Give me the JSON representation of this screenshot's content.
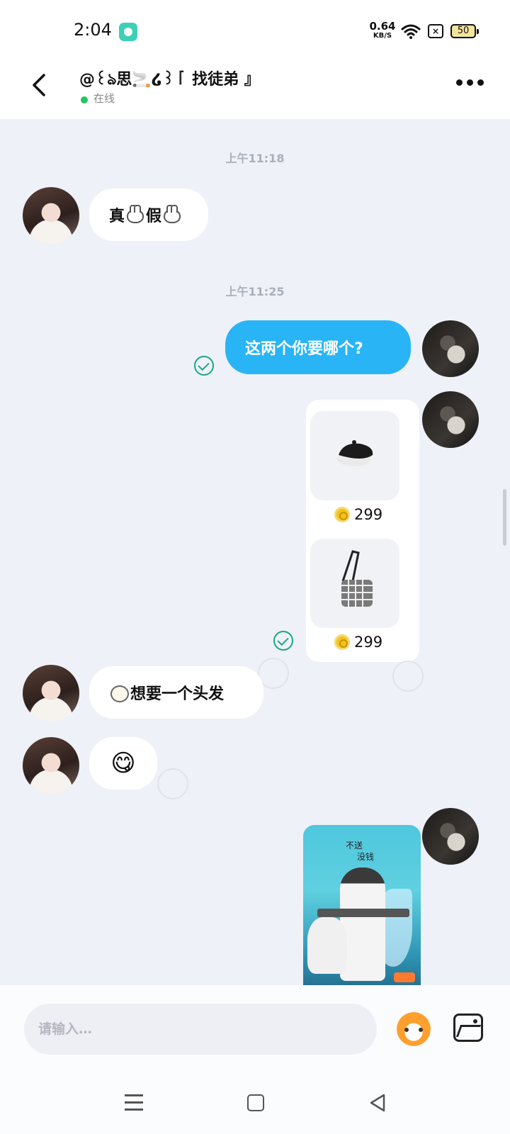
{
  "status_bar": {
    "time": "2:04",
    "net_speed_value": "0.64",
    "net_speed_unit": "KB/S",
    "battery": "50",
    "icons": [
      "app-notification-icon",
      "wifi-icon",
      "sim-icon",
      "battery-icon"
    ]
  },
  "header": {
    "contact_name": "@꒰ঌ思🚬໒꒱『 找徒弟 』",
    "status": "在线",
    "icons": [
      "back-icon",
      "more-icon"
    ]
  },
  "chat": {
    "messages": [
      {
        "type": "timestamp",
        "text": "上午11:18"
      },
      {
        "type": "incoming",
        "text_parts": [
          "真",
          "假"
        ]
      },
      {
        "type": "timestamp",
        "text": "上午11:25"
      },
      {
        "type": "outgoing",
        "text": "这两个你要哪个?"
      },
      {
        "type": "outgoing-products",
        "products": [
          {
            "item": "black beret hat",
            "price": "299"
          },
          {
            "item": "plaid shoulder bag",
            "price": "299"
          }
        ]
      },
      {
        "type": "incoming",
        "text": "想要一个头发"
      },
      {
        "type": "incoming",
        "emoji": "😋"
      },
      {
        "type": "outgoing-image",
        "image_text_top": "不送",
        "image_text_bottom": "没钱"
      }
    ]
  },
  "input": {
    "placeholder": "请输入…",
    "icons": [
      "mascot-sticker-icon",
      "image-picker-icon"
    ]
  },
  "nav_bar": {
    "icons": [
      "menu-icon",
      "home-icon",
      "back-triangle-icon"
    ]
  },
  "colors": {
    "outgoing_bubble": "#29b4f6",
    "incoming_bubble": "#ffffff",
    "online": "#22c55e",
    "read_check": "#1aa68a",
    "coin": "#f2c21b"
  }
}
